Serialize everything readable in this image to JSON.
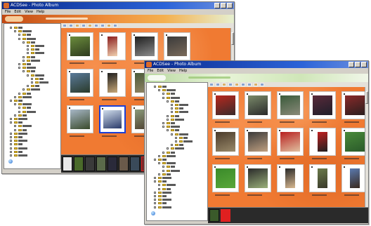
{
  "windows": [
    {
      "id": "back",
      "title": "ACDSee - Photo Album",
      "menu": [
        "File",
        "Edit",
        "View",
        "Help"
      ],
      "rows": [
        [
          {
            "kind": "landscape",
            "colors": [
              "#6b8c3c",
              "#2d3a1e"
            ]
          },
          {
            "kind": "portrait",
            "colors": [
              "#8b1e1e",
              "#f0d0b0"
            ]
          },
          {
            "kind": "landscape",
            "colors": [
              "#1e1e1e",
              "#8c8c8c"
            ]
          },
          {
            "kind": "landscape",
            "colors": [
              "#3a3a3a",
              "#7a6a5a"
            ]
          }
        ],
        [
          {
            "kind": "landscape",
            "colors": [
              "#5a7a9a",
              "#2a3a2a"
            ]
          },
          {
            "kind": "portrait",
            "colors": [
              "#1e1e1e",
              "#c8a878"
            ]
          },
          {
            "kind": "landscape",
            "colors": [
              "#4a5a3a",
              "#9a8a6a"
            ]
          }
        ],
        [
          {
            "kind": "landscape",
            "colors": [
              "#a8b8c8",
              "#3a4a2a"
            ]
          },
          {
            "kind": "landscape",
            "colors": [
              "#cfdceb",
              "#2a3a6a"
            ],
            "selected": true
          },
          {
            "kind": "landscape",
            "colors": [
              "#8a9a7a",
              "#4a3a2a"
            ]
          }
        ]
      ],
      "filmstrip": [
        "#4a6a2a",
        "#3a3a3a",
        "#5a6a4a",
        "#2a2a3a",
        "#6a5a4a",
        "#3a4a5a",
        "#7a2a2a"
      ],
      "filmstrip_current": 6
    },
    {
      "id": "front",
      "title": "ACDSee - Photo Album",
      "menu": [
        "File",
        "Edit",
        "View",
        "Help"
      ],
      "rows": [
        [
          {
            "kind": "landscape",
            "colors": [
              "#b8281e",
              "#3a2a2a"
            ]
          },
          {
            "kind": "landscape",
            "colors": [
              "#7a8a6a",
              "#2a2a2a"
            ]
          },
          {
            "kind": "landscape",
            "colors": [
              "#3a5a3a",
              "#8a8a7a"
            ]
          },
          {
            "kind": "landscape",
            "colors": [
              "#5a2a3a",
              "#1e1e2a"
            ]
          },
          {
            "kind": "landscape",
            "colors": [
              "#8a2a2a",
              "#2a1e1e"
            ]
          }
        ],
        [
          {
            "kind": "landscape",
            "colors": [
              "#4a3a2a",
              "#9a8a6a"
            ]
          },
          {
            "kind": "landscape",
            "colors": [
              "#3a3a3a",
              "#c0a080"
            ]
          },
          {
            "kind": "landscape",
            "colors": [
              "#b82020",
              "#e0c0a0"
            ]
          },
          {
            "kind": "portrait",
            "colors": [
              "#c02020",
              "#202020"
            ]
          },
          {
            "kind": "landscape",
            "colors": [
              "#4a8a3a",
              "#2a5a2a"
            ]
          }
        ],
        [
          {
            "kind": "landscape",
            "colors": [
              "#3a8a2a",
              "#5aa83a"
            ]
          },
          {
            "kind": "landscape",
            "colors": [
              "#2a2a2a",
              "#9ab07a"
            ]
          },
          {
            "kind": "portrait",
            "colors": [
              "#2a2a2a",
              "#d8b890"
            ]
          },
          {
            "kind": "portrait",
            "colors": [
              "#6a7a4a",
              "#3a3a2a"
            ]
          },
          {
            "kind": "portrait",
            "colors": [
              "#5a7ab0",
              "#3a2a1e"
            ]
          }
        ]
      ],
      "filmstrip": [
        "#3a5a2a",
        "#e02020"
      ],
      "filmstrip_current": 1
    }
  ]
}
